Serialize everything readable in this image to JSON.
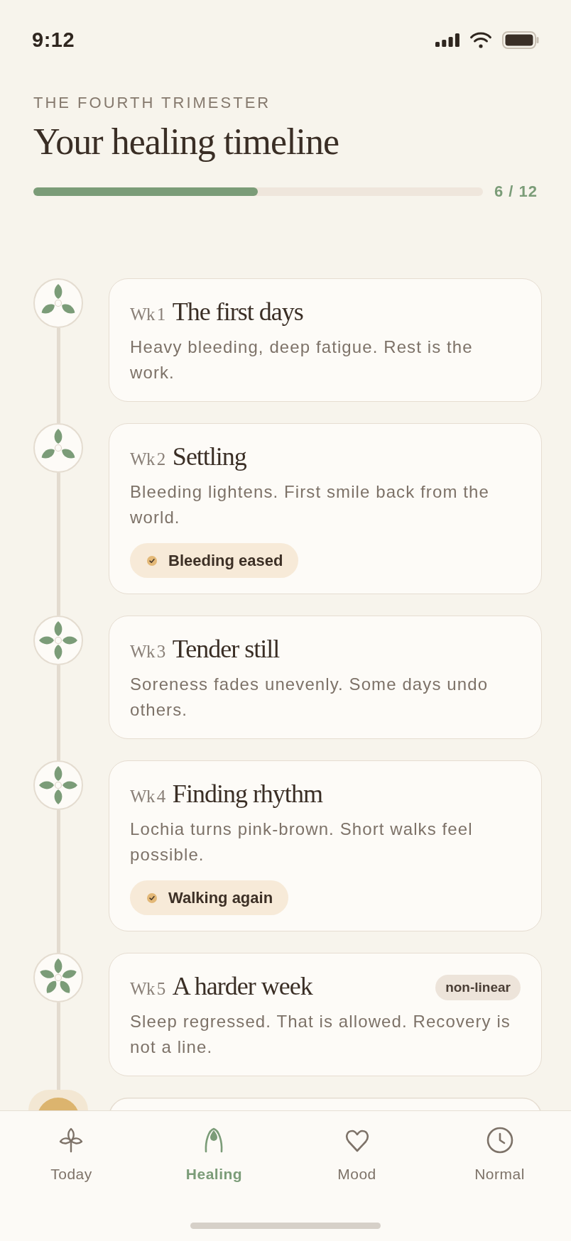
{
  "status_bar": {
    "time": "9:12"
  },
  "header": {
    "eyebrow": "THE FOURTH TRIMESTER",
    "title": "Your healing timeline"
  },
  "progress": {
    "level": 0.5,
    "label": "6 / 12"
  },
  "timeline": [
    {
      "current": false,
      "week": "Wk 1",
      "title": "The first days",
      "description": "Heavy bleeding, deep fatigue. Rest is the work."
    },
    {
      "current": false,
      "week": "Wk 2",
      "title": "Settling",
      "description": "Bleeding lightens. First smile back from the world.",
      "milestone": "Bleeding eased"
    },
    {
      "current": false,
      "week": "Wk 3",
      "title": "Tender still",
      "description": "Soreness fades unevenly. Some days undo others."
    },
    {
      "current": false,
      "week": "Wk 4",
      "title": "Finding rhythm",
      "description": "Lochia turns pink-brown. Short walks feel possible.",
      "milestone": "Walking again"
    },
    {
      "current": false,
      "week": "Wk 5",
      "title": "A harder week",
      "description": "Sleep regressed. That is allowed. Recovery is not a line.",
      "tag": "non-linear"
    },
    {
      "current": true
    }
  ],
  "nav": {
    "items": [
      {
        "label": "Today",
        "selected": false
      },
      {
        "label": "Healing",
        "selected": true
      },
      {
        "label": "Mood",
        "selected": false
      },
      {
        "label": "Normal",
        "selected": false
      }
    ]
  }
}
